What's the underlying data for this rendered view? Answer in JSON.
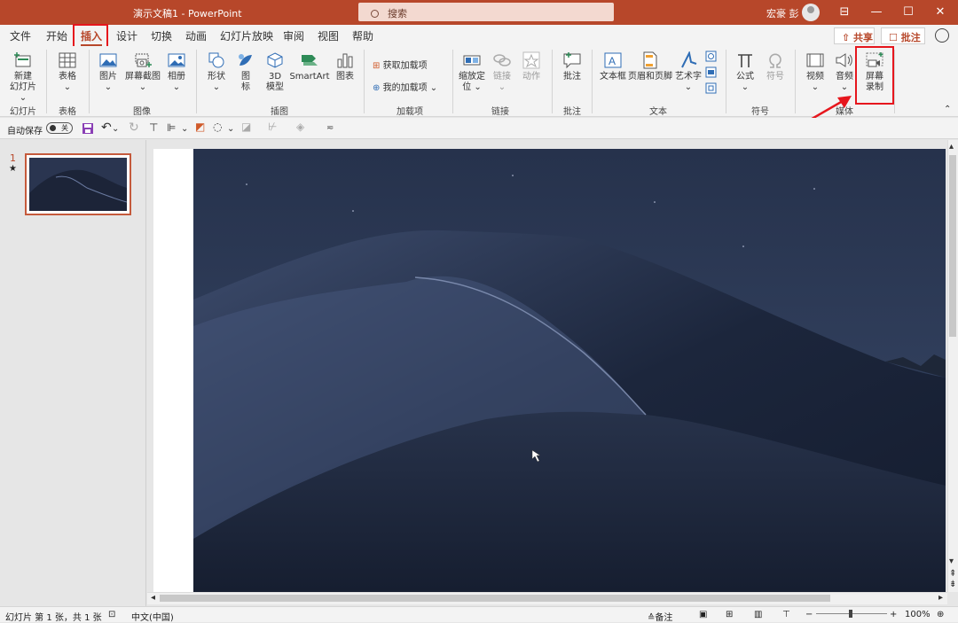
{
  "window": {
    "title": "演示文稿1  -  PowerPoint",
    "search_placeholder": "搜索",
    "user_name": "宏豪 彭",
    "controls": [
      "⊟",
      "—",
      "☐",
      "✕"
    ]
  },
  "menu": {
    "tabs": [
      "文件",
      "开始",
      "插入",
      "设计",
      "切换",
      "动画",
      "幻灯片放映",
      "审阅",
      "视图",
      "帮助"
    ],
    "active_tab": "插入",
    "share": "共享",
    "comment": "批注"
  },
  "ribbon": {
    "groups": {
      "slides": "幻灯片",
      "tables": "表格",
      "images": "图像",
      "illustrations": "插图",
      "addins": "加载项",
      "links": "链接",
      "comments": "批注",
      "text": "文本",
      "symbols": "符号",
      "media": "媒体"
    },
    "buttons": {
      "new_slide_1": "新建",
      "new_slide_2": "幻灯片 ⌄",
      "table": "表格",
      "picture": "图片",
      "screenshot": "屏幕截图",
      "album": "相册",
      "shapes": "形状",
      "icons_1": "图",
      "icons_2": "标",
      "model_1": "3D",
      "model_2": "模型",
      "smartart": "SmartArt",
      "chart": "图表",
      "get_addins": "获取加载项",
      "my_addins": "我的加载项",
      "zoom_1": "缩放定",
      "zoom_2": "位 ⌄",
      "link": "链接",
      "action": "动作",
      "comment": "批注",
      "textbox": "文本框",
      "header_footer": "页眉和页脚",
      "wordart": "艺术字",
      "equation": "公式",
      "symbol": "符号",
      "video": "视频",
      "audio": "音频",
      "screen_record_1": "屏幕",
      "screen_record_2": "录制"
    }
  },
  "qat": {
    "autosave": "自动保存",
    "toggle": "关"
  },
  "thumbs": {
    "number": "1",
    "star": "★"
  },
  "status": {
    "slide_info": "幻灯片 第 1 张，共 1 张",
    "language": "中文(中国)",
    "notes": "≙备注",
    "zoom": "100%"
  },
  "colors": {
    "accent": "#b7472a",
    "highlight": "#e6161d"
  }
}
